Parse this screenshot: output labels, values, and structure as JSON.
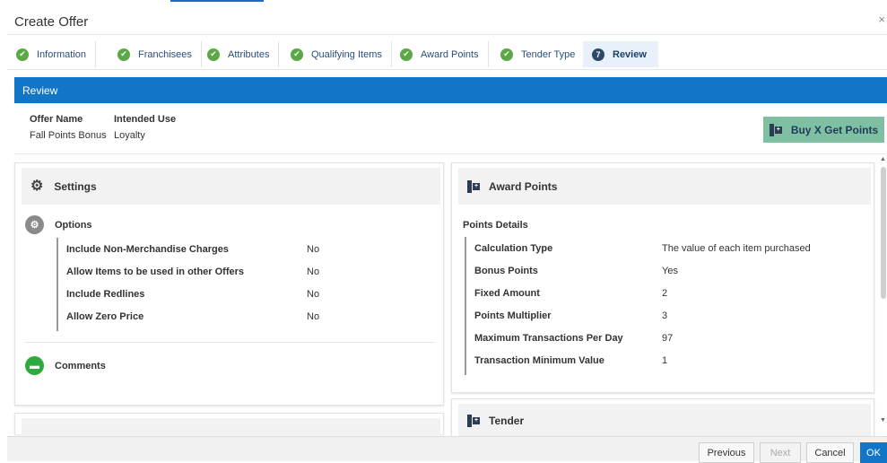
{
  "window": {
    "title": "Create Offer",
    "close_glyph": "×"
  },
  "tabs": [
    {
      "label": "Information",
      "status": "complete"
    },
    {
      "label": "Franchisees",
      "status": "complete"
    },
    {
      "label": "Attributes",
      "status": "complete"
    },
    {
      "label": "Qualifying Items",
      "status": "complete"
    },
    {
      "label": "Award Points",
      "status": "complete"
    },
    {
      "label": "Tender Type",
      "status": "complete"
    },
    {
      "label": "Review",
      "status": "active",
      "step": "7"
    }
  ],
  "review_bar": {
    "title": "Review"
  },
  "summary": {
    "offer_name_label": "Offer Name",
    "offer_name_value": "Fall Points Bonus",
    "intended_use_label": "Intended Use",
    "intended_use_value": "Loyalty",
    "offer_type_label": "Buy X Get Points"
  },
  "settings": {
    "title": "Settings",
    "options_title": "Options",
    "options": [
      {
        "label": "Include Non-Merchandise Charges",
        "value": "No"
      },
      {
        "label": "Allow Items to be used in other Offers",
        "value": "No"
      },
      {
        "label": "Include Redlines",
        "value": "No"
      },
      {
        "label": "Allow Zero Price",
        "value": "No"
      }
    ],
    "comments_title": "Comments"
  },
  "award_points": {
    "title": "Award Points",
    "details_title": "Points Details",
    "details": [
      {
        "label": "Calculation Type",
        "value": "The value of each item purchased"
      },
      {
        "label": "Bonus Points",
        "value": "Yes"
      },
      {
        "label": "Fixed Amount",
        "value": "2"
      },
      {
        "label": "Points Multiplier",
        "value": "3"
      },
      {
        "label": "Maximum Transactions Per Day",
        "value": "97"
      },
      {
        "label": "Transaction Minimum Value",
        "value": "1"
      }
    ]
  },
  "tender": {
    "title": "Tender"
  },
  "footer": {
    "previous": "Previous",
    "next": "Next",
    "cancel": "Cancel",
    "ok": "OK"
  },
  "colors": {
    "accent": "#1276c8",
    "complete": "#5aa846",
    "offer_type": "#7fc0a3",
    "comments": "#2eaa3f"
  },
  "icons": {
    "complete": "check-circle-icon",
    "settings": "gear-icon",
    "options": "settings-circle-icon",
    "comments": "chat-bubble-icon",
    "points": "points-block-icon"
  }
}
